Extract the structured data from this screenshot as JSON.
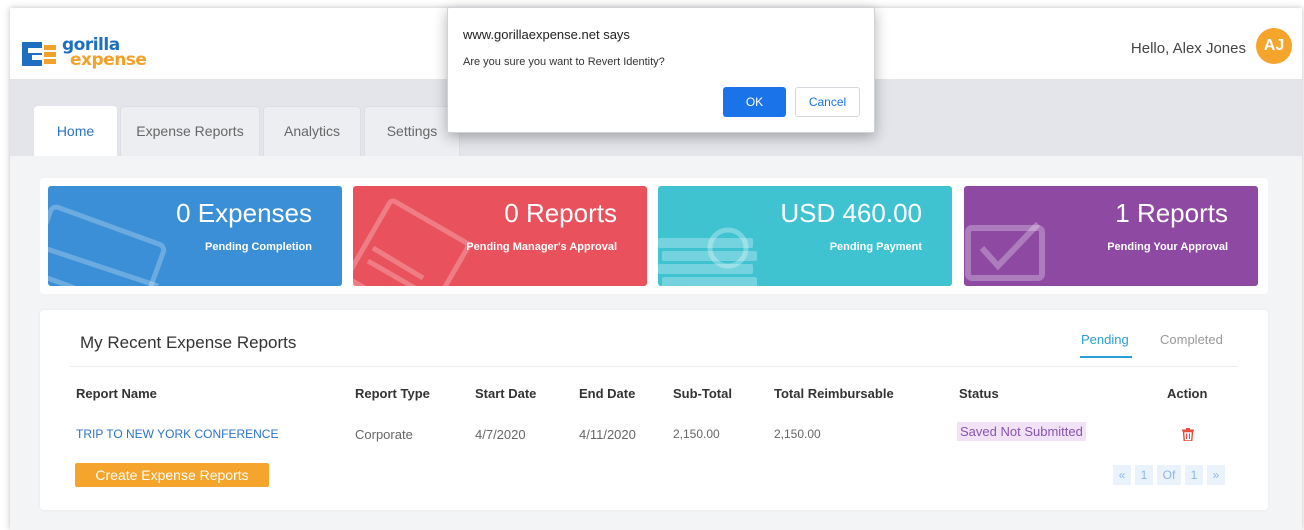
{
  "header": {
    "logo_line1": "gorilla",
    "logo_line2": "expense",
    "greeting": "Hello, Alex Jones",
    "avatar_initials": "AJ"
  },
  "tabs": [
    {
      "label": "Home",
      "active": true
    },
    {
      "label": "Expense Reports",
      "active": false
    },
    {
      "label": "Analytics",
      "active": false
    },
    {
      "label": "Settings",
      "active": false
    }
  ],
  "stats": [
    {
      "value": "0 Expenses",
      "caption": "Pending Completion",
      "color": "#3b8fd6",
      "icon": "credit-card-icon"
    },
    {
      "value": "0 Reports",
      "caption": "Pending Manager's Approval",
      "color": "#e9525c",
      "icon": "document-icon"
    },
    {
      "value": "USD 460.00",
      "caption": "Pending Payment",
      "color": "#3fc3d1",
      "icon": "money-stack-icon"
    },
    {
      "value": "1 Reports",
      "caption": "Pending Your Approval",
      "color": "#8e4aa3",
      "icon": "checkbox-icon"
    }
  ],
  "recent": {
    "title": "My Recent Expense Reports",
    "filters": [
      "Pending",
      "Completed"
    ],
    "active_filter": "Pending",
    "columns": [
      "Report Name",
      "Report Type",
      "Start Date",
      "End Date",
      "Sub-Total",
      "Total Reimbursable",
      "Status",
      "Action"
    ],
    "rows": [
      {
        "name": "TRIP TO NEW YORK CONFERENCE",
        "type": "Corporate",
        "start": "4/7/2020",
        "end": "4/11/2020",
        "subtotal": "2,150.00",
        "reimbursable": "2,150.00",
        "status": "Saved Not Submitted",
        "action_icon": "trash-icon"
      }
    ],
    "create_button": "Create Expense Reports",
    "pager": {
      "first": "«",
      "page": "1",
      "of": "Of",
      "total": "1",
      "last": "»"
    }
  },
  "dialog": {
    "title": "www.gorillaexpense.net says",
    "message": "Are you sure you want to Revert Identity?",
    "ok": "OK",
    "cancel": "Cancel",
    "ok_color": "#1a73e8"
  }
}
